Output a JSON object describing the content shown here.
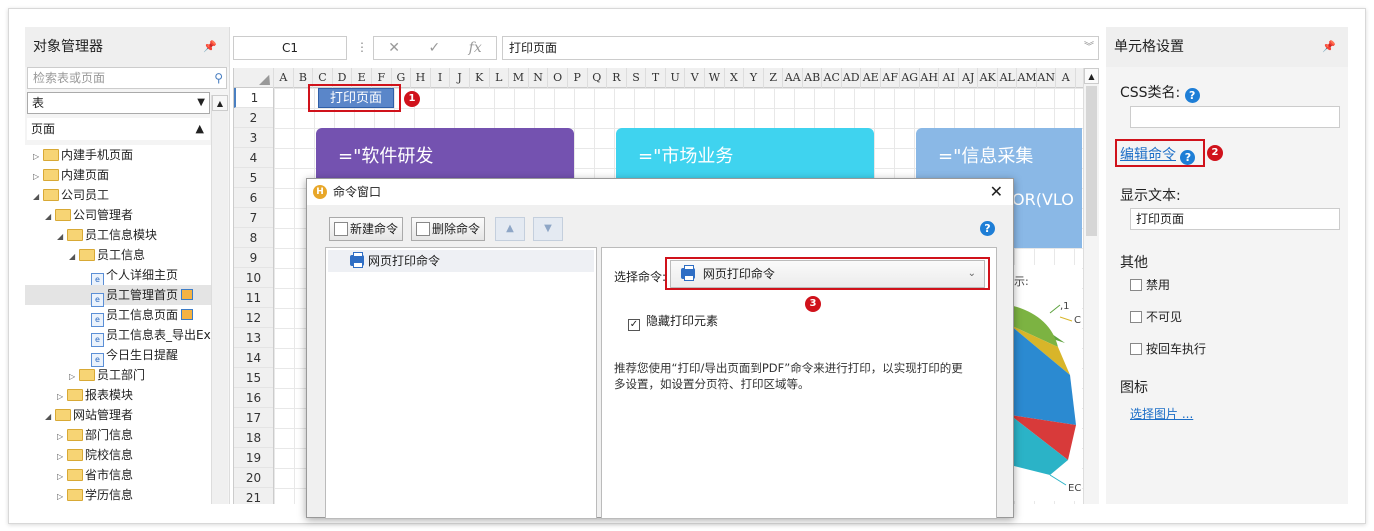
{
  "object_manager": {
    "title": "对象管理器",
    "search_placeholder": "检索表或页面",
    "type_select": "表",
    "section": "页面",
    "tree": [
      {
        "label": "内建手机页面",
        "level": 0,
        "type": "folder",
        "expanded": false
      },
      {
        "label": "内建页面",
        "level": 0,
        "type": "folder",
        "expanded": false
      },
      {
        "label": "公司员工",
        "level": 0,
        "type": "folder",
        "expanded": true
      },
      {
        "label": "公司管理者",
        "level": 1,
        "type": "folder",
        "expanded": true
      },
      {
        "label": "员工信息模块",
        "level": 2,
        "type": "folder",
        "expanded": true
      },
      {
        "label": "员工信息",
        "level": 3,
        "type": "folder",
        "expanded": true
      },
      {
        "label": "个人详细主页",
        "level": 4,
        "type": "page"
      },
      {
        "label": "员工管理首页",
        "level": 4,
        "type": "page",
        "selected": true,
        "badge": true
      },
      {
        "label": "员工信息页面",
        "level": 4,
        "type": "page",
        "badge": true
      },
      {
        "label": "员工信息表_导出Ex",
        "level": 4,
        "type": "page"
      },
      {
        "label": "今日生日提醒",
        "level": 4,
        "type": "page"
      },
      {
        "label": "员工部门",
        "level": 3,
        "type": "folder",
        "expanded": false
      },
      {
        "label": "报表模块",
        "level": 2,
        "type": "folder",
        "expanded": false
      },
      {
        "label": "网站管理者",
        "level": 1,
        "type": "folder",
        "expanded": true
      },
      {
        "label": "部门信息",
        "level": 2,
        "type": "folder",
        "expanded": false
      },
      {
        "label": "院校信息",
        "level": 2,
        "type": "folder",
        "expanded": false
      },
      {
        "label": "省市信息",
        "level": 2,
        "type": "folder",
        "expanded": false
      },
      {
        "label": "学历信息",
        "level": 2,
        "type": "folder",
        "expanded": false
      }
    ]
  },
  "formula_bar": {
    "cell_ref": "C1",
    "value": "打印页面"
  },
  "sheet": {
    "columns": [
      "A",
      "B",
      "C",
      "D",
      "E",
      "F",
      "G",
      "H",
      "I",
      "J",
      "K",
      "L",
      "M",
      "N",
      "O",
      "P",
      "Q",
      "R",
      "S",
      "T",
      "U",
      "V",
      "W",
      "X",
      "Y",
      "Z",
      "AA",
      "AB",
      "AC",
      "AD",
      "AE",
      "AF",
      "AG",
      "AH",
      "AI",
      "AJ",
      "AK",
      "AL",
      "AM",
      "AN",
      "A"
    ],
    "rows": [
      "1",
      "2",
      "3",
      "4",
      "5",
      "6",
      "7",
      "8",
      "9",
      "10",
      "11",
      "12",
      "13",
      "14",
      "15",
      "16",
      "17",
      "18",
      "19",
      "20",
      "21"
    ],
    "cell_button": "打印页面",
    "cards": [
      {
        "text": "=\"软件研发",
        "color": "#7452b0"
      },
      {
        "text": "=\"市场业务",
        "color": "#3fd3ef"
      },
      {
        "text": "=\"信息采集",
        "color": "#8ab8e6"
      }
    ],
    "card_formula_tail": "OR(VLO",
    "chart_fragments": {
      "label_1": ",1",
      "label_c": "C",
      "label_ec": "EC",
      "label_tail": "示:"
    }
  },
  "callouts": [
    "1",
    "2",
    "3"
  ],
  "cell_settings": {
    "title": "单元格设置",
    "css_label": "CSS类名:",
    "css_value": "",
    "edit_command": "编辑命令",
    "display_text_label": "显示文本:",
    "display_text_value": "打印页面",
    "other_label": "其他",
    "checkboxes": [
      "禁用",
      "不可见",
      "按回车执行"
    ],
    "icon_label": "图标",
    "select_image": "选择图片 ..."
  },
  "dialog": {
    "title": "命令窗口",
    "new_command": "新建命令",
    "delete_command": "删除命令",
    "command_list": [
      "网页打印命令"
    ],
    "select_label": "选择命令:",
    "selected_command": "网页打印命令",
    "hide_print_elements": "隐藏打印元素",
    "tip": "推荐您使用“打印/导出页面到PDF”命令来进行打印，以实现打印的更多设置，如设置分页符、打印区域等。"
  },
  "colors": {
    "accent": "#1e7ed6",
    "callout": "#d0121b",
    "cell_button": "#5a86c9"
  }
}
